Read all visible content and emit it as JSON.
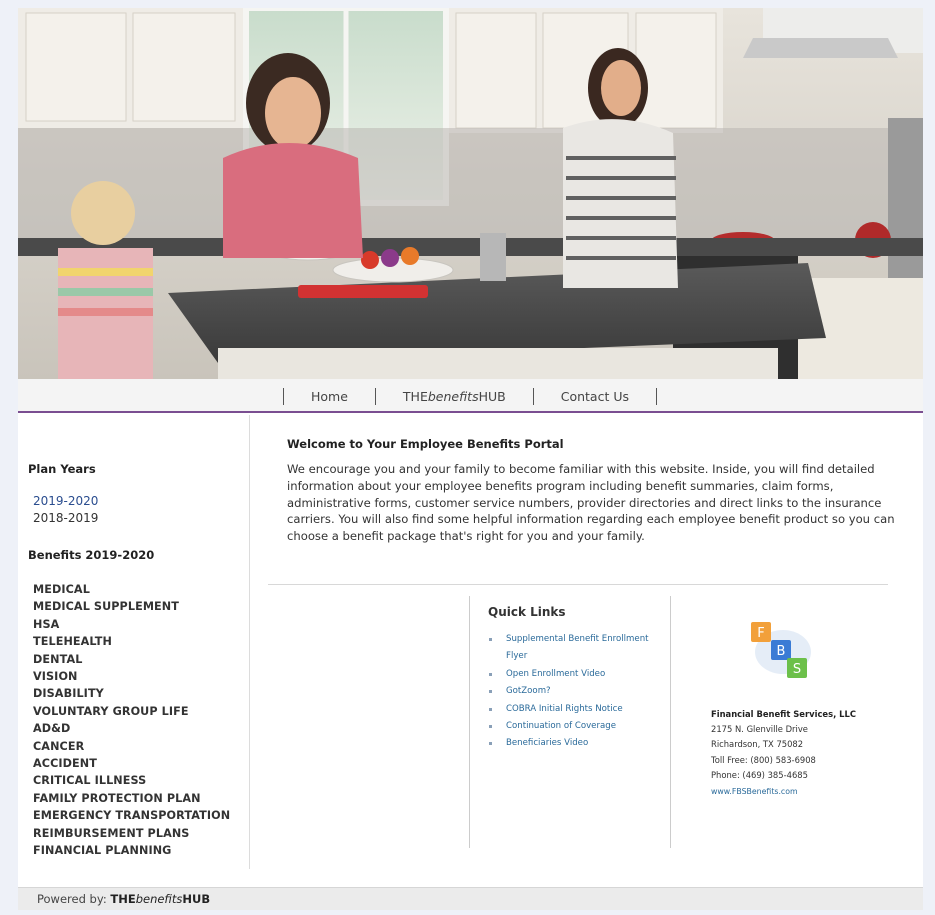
{
  "hero": {
    "alt": "Family in kitchen"
  },
  "nav": {
    "items": [
      {
        "pre": "Home",
        "em": "",
        "post": ""
      },
      {
        "pre": "THE",
        "em": "benefits",
        "post": "HUB"
      },
      {
        "pre": "Contact Us",
        "em": "",
        "post": ""
      }
    ],
    "accent_color": "#7a4e91"
  },
  "sidebar": {
    "plan_years_heading": "Plan Years",
    "plan_years": [
      "2019-2020",
      "2018-2019"
    ],
    "benefits_heading": "Benefits 2019-2020",
    "benefits": [
      "MEDICAL",
      "MEDICAL SUPPLEMENT",
      "HSA",
      "TELEHEALTH",
      "DENTAL",
      "VISION",
      "DISABILITY",
      "VOLUNTARY GROUP LIFE",
      "AD&D",
      "CANCER",
      "ACCIDENT",
      "CRITICAL ILLNESS",
      "FAMILY PROTECTION PLAN",
      "EMERGENCY TRANSPORTATION",
      "REIMBURSEMENT PLANS",
      "FINANCIAL PLANNING"
    ]
  },
  "welcome": {
    "title": "Welcome to Your Employee Benefits Portal",
    "body": "We encourage you and your family to become familiar with this website.  Inside, you will find detailed information about your employee benefits program including benefit summaries, claim forms, administrative forms, customer service numbers, provider directories and direct links to the insurance carriers.  You will also find some helpful information regarding each employee benefit product so you can choose a benefit package that's right for you and your family."
  },
  "quick_links": {
    "heading": "Quick Links",
    "items": [
      "Supplemental Benefit Enrollment Flyer",
      "Open Enrollment Video",
      "GotZoom?",
      "COBRA Initial Rights Notice",
      "Continuation of Coverage",
      "Beneficiaries Video"
    ]
  },
  "contact": {
    "logo_letters": [
      "F",
      "B",
      "S"
    ],
    "logo_colors": [
      "#f2a03a",
      "#3a7bd5",
      "#6cc04a"
    ],
    "company": "Financial Benefit Services, LLC",
    "address1": "2175 N. Glenville Drive",
    "address2": "Richardson, TX 75082",
    "tollfree": "Toll Free: (800) 583-6908",
    "phone": "Phone: (469) 385-4685",
    "website": "www.FBSBenefits.com"
  },
  "footer": {
    "powered_by": "Powered by:",
    "brand_pre": "THE",
    "brand_em": "benefits",
    "brand_post": "HUB"
  }
}
